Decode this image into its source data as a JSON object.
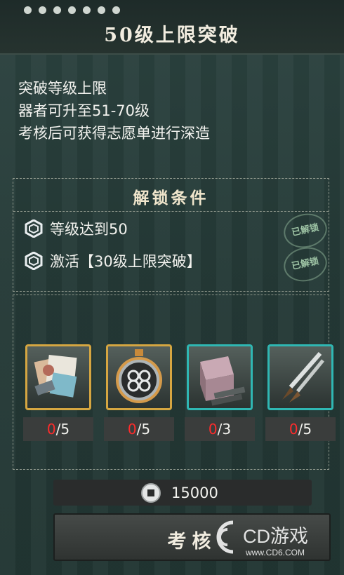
{
  "header": {
    "title": "50级上限突破"
  },
  "description": [
    "突破等级上限",
    "器者可升至51-70级",
    "考核后可获得志愿单进行深造"
  ],
  "unlock": {
    "title": "解锁条件",
    "conditions": [
      {
        "text": "等级达到50",
        "stamp": "已解锁"
      },
      {
        "text": "激活【30级上限突破】",
        "stamp": "已解锁"
      }
    ]
  },
  "materials": [
    {
      "icon": "documents-icon",
      "rarity": "gold",
      "have": "0",
      "need": "/5"
    },
    {
      "icon": "medallion-icon",
      "rarity": "gold",
      "have": "0",
      "need": "/5"
    },
    {
      "icon": "box-with-bars-icon",
      "rarity": "teal",
      "have": "0",
      "need": "/3"
    },
    {
      "icon": "brushes-icon",
      "rarity": "teal",
      "have": "0",
      "need": "/5"
    }
  ],
  "cost": {
    "icon": "coin-icon",
    "amount": "15000"
  },
  "action": {
    "label": "考核"
  },
  "watermark": {
    "brand": "CD游戏",
    "url": "www.CD6.COM"
  },
  "colors": {
    "have_count": "#ff2b2b",
    "gold_frame": "#d5a641",
    "teal_frame": "#2fb7b3"
  }
}
